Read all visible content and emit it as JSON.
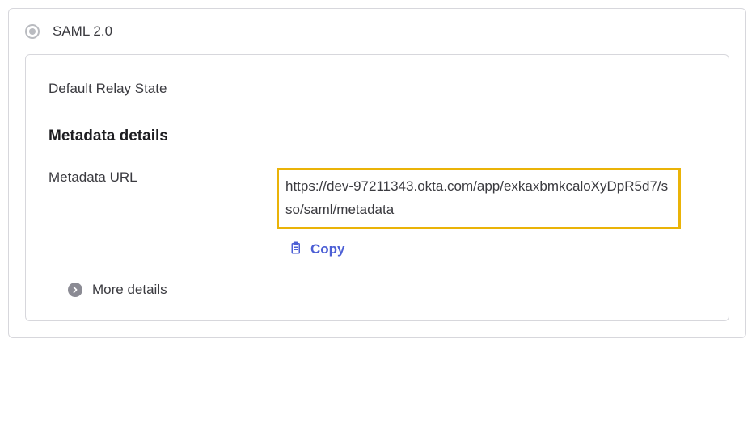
{
  "protocol": {
    "label": "SAML 2.0"
  },
  "fields": {
    "relay_state": {
      "label": "Default Relay State",
      "value": ""
    }
  },
  "metadata": {
    "heading": "Metadata details",
    "url_label": "Metadata URL",
    "url_value": "https://dev-97211343.okta.com/app/exkaxbmkcaloXyDpR5d7/sso/saml/metadata",
    "copy_label": "Copy"
  },
  "more_details": {
    "label": "More details"
  }
}
